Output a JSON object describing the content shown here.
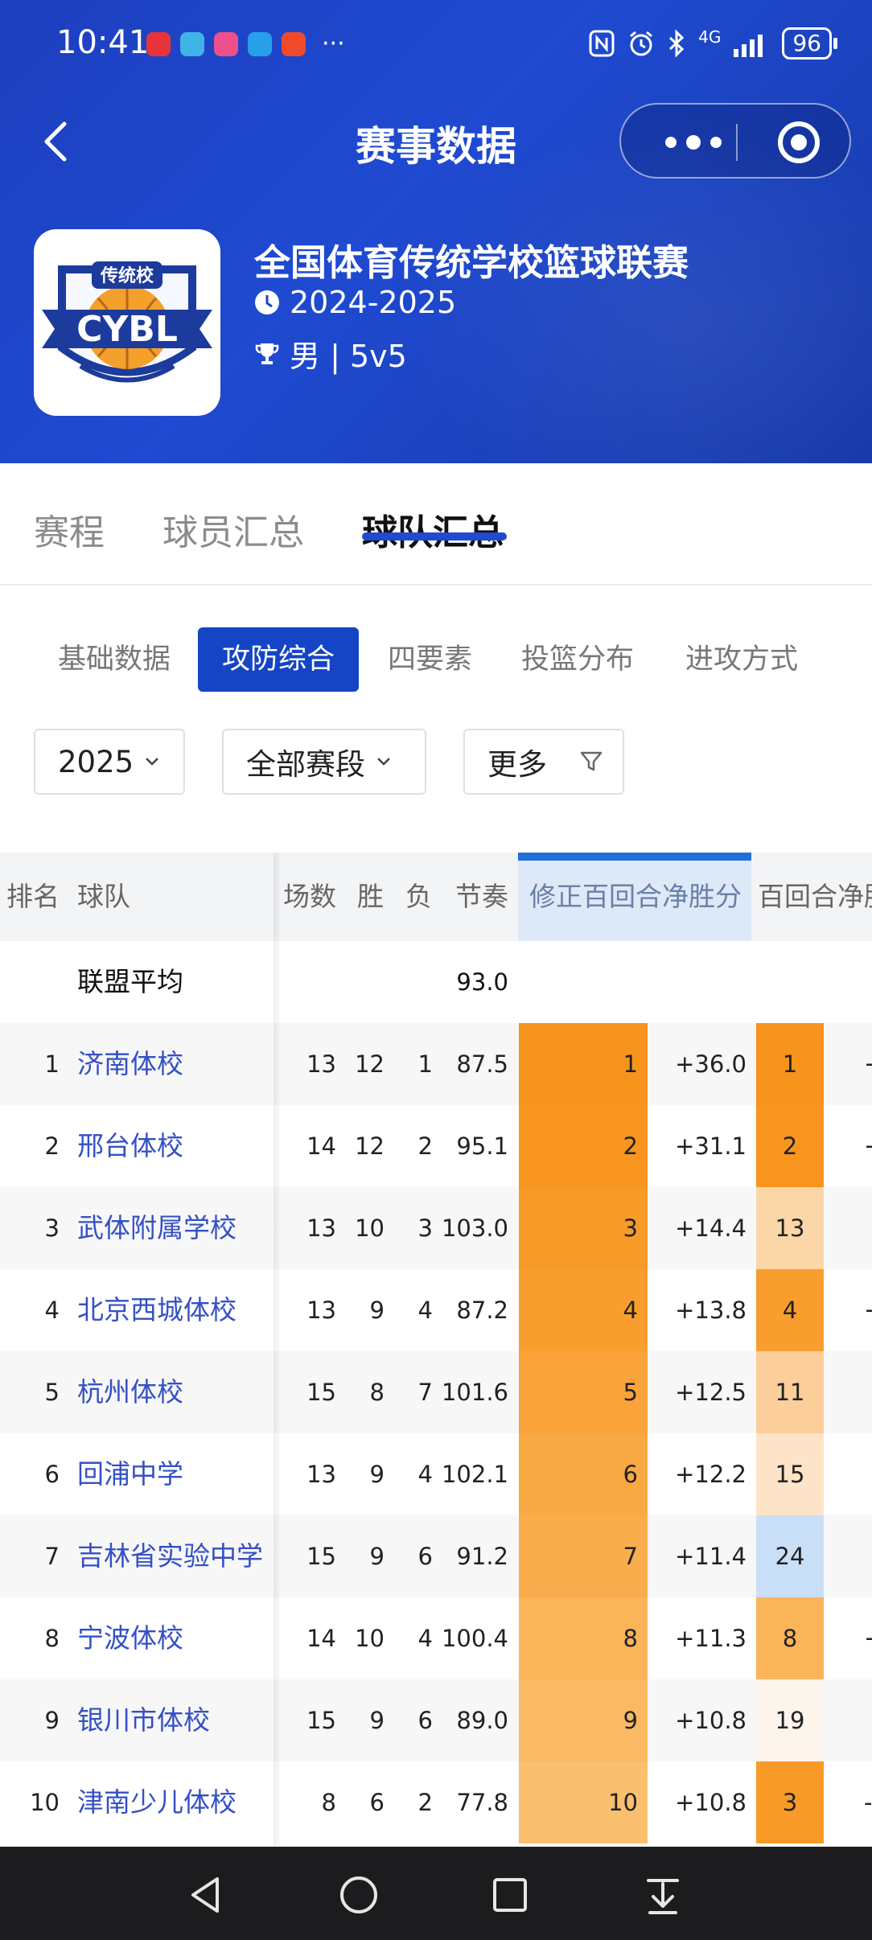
{
  "status_bar": {
    "time": "10:41",
    "more": "···",
    "battery": "96",
    "network": "4G"
  },
  "header": {
    "title": "赛事数据",
    "league_name": "全国体育传统学校篮球联赛",
    "season": "2024-2025",
    "category": "男 | 5v5",
    "logo_top_text": "传统校",
    "logo_text": "CYBL"
  },
  "main_tabs": [
    {
      "label": "赛程"
    },
    {
      "label": "球员汇总"
    },
    {
      "label": "球队汇总"
    }
  ],
  "sub_tabs": [
    {
      "label": "基础数据"
    },
    {
      "label": "攻防综合"
    },
    {
      "label": "四要素"
    },
    {
      "label": "投篮分布"
    },
    {
      "label": "进攻方式"
    }
  ],
  "filters": {
    "year": "2025",
    "stage": "全部赛段",
    "more": "更多"
  },
  "table": {
    "headers": {
      "rank": "排名",
      "team": "球队",
      "games": "场数",
      "wins": "胜",
      "losses": "负",
      "pace": "节奏",
      "adj_net": "修正百回合净胜分",
      "net": "百回合净胜"
    },
    "league_avg": {
      "label": "联盟平均",
      "pace": "93.0"
    },
    "rows": [
      {
        "rank": "1",
        "team": "济南体校",
        "games": "13",
        "wins": "12",
        "losses": "1",
        "pace": "87.5",
        "adj_rank": "1",
        "adj_value": "+36.0",
        "net_rank": "1",
        "net_partial": "+"
      },
      {
        "rank": "2",
        "team": "邢台体校",
        "games": "14",
        "wins": "12",
        "losses": "2",
        "pace": "95.1",
        "adj_rank": "2",
        "adj_value": "+31.1",
        "net_rank": "2",
        "net_partial": "+"
      },
      {
        "rank": "3",
        "team": "武体附属学校",
        "games": "13",
        "wins": "10",
        "losses": "3",
        "pace": "103.0",
        "adj_rank": "3",
        "adj_value": "+14.4",
        "net_rank": "13",
        "net_partial": ""
      },
      {
        "rank": "4",
        "team": "北京西城体校",
        "games": "13",
        "wins": "9",
        "losses": "4",
        "pace": "87.2",
        "adj_rank": "4",
        "adj_value": "+13.8",
        "net_rank": "4",
        "net_partial": "+"
      },
      {
        "rank": "5",
        "team": "杭州体校",
        "games": "15",
        "wins": "8",
        "losses": "7",
        "pace": "101.6",
        "adj_rank": "5",
        "adj_value": "+12.5",
        "net_rank": "11",
        "net_partial": ""
      },
      {
        "rank": "6",
        "team": "回浦中学",
        "games": "13",
        "wins": "9",
        "losses": "4",
        "pace": "102.1",
        "adj_rank": "6",
        "adj_value": "+12.2",
        "net_rank": "15",
        "net_partial": ""
      },
      {
        "rank": "7",
        "team": "吉林省实验中学",
        "games": "15",
        "wins": "9",
        "losses": "6",
        "pace": "91.2",
        "adj_rank": "7",
        "adj_value": "+11.4",
        "net_rank": "24",
        "net_partial": ""
      },
      {
        "rank": "8",
        "team": "宁波体校",
        "games": "14",
        "wins": "10",
        "losses": "4",
        "pace": "100.4",
        "adj_rank": "8",
        "adj_value": "+11.3",
        "net_rank": "8",
        "net_partial": "+"
      },
      {
        "rank": "9",
        "team": "银川市体校",
        "games": "15",
        "wins": "9",
        "losses": "6",
        "pace": "89.0",
        "adj_rank": "9",
        "adj_value": "+10.8",
        "net_rank": "19",
        "net_partial": ""
      },
      {
        "rank": "10",
        "team": "津南少儿体校",
        "games": "8",
        "wins": "6",
        "losses": "2",
        "pace": "77.8",
        "adj_rank": "10",
        "adj_value": "+10.8",
        "net_rank": "3",
        "net_partial": "-"
      }
    ],
    "colors": {
      "adj_rank_heat": [
        "#f7941d",
        "#f7951f",
        "#f89a27",
        "#f89e2f",
        "#f9a33a",
        "#f9a944",
        "#faad4d",
        "#fab459",
        "#fbb964",
        "#fbbf70"
      ],
      "net_rank_heat": [
        "#f7941d",
        "#f7951f",
        "#fbd7a8",
        "#f89e2f",
        "#fcce99",
        "#fde3c7",
        "#c8dff7",
        "#fab459",
        "#fdf5ec",
        "#f89a27"
      ]
    }
  }
}
